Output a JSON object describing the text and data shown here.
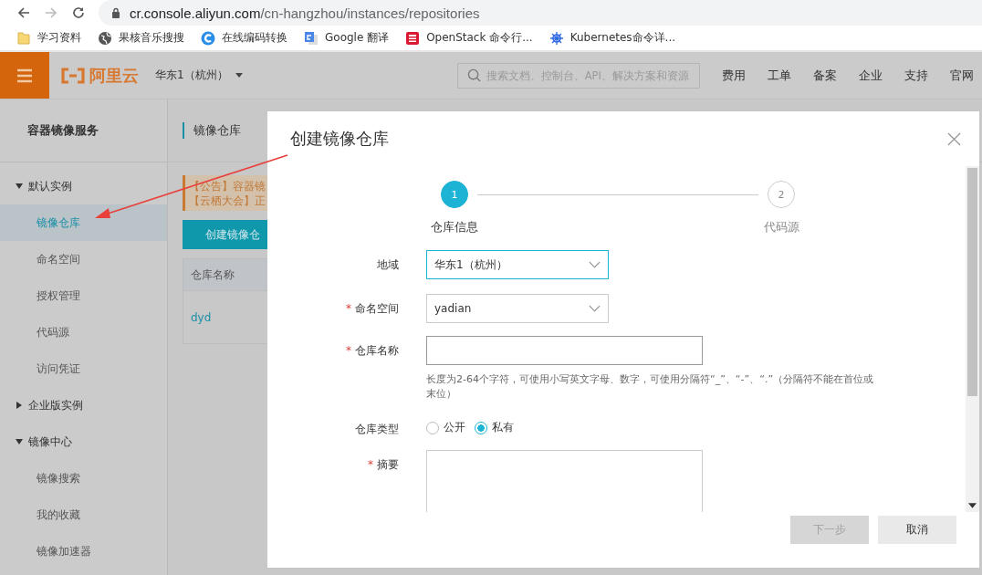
{
  "browser": {
    "url_host": "cr.console.aliyun.com",
    "url_path": "/cn-hangzhou/instances/repositories"
  },
  "bookmarks": [
    {
      "label": "学习资料",
      "kind": "folder"
    },
    {
      "label": "果核音乐搜搜",
      "kind": "globe"
    },
    {
      "label": "在线编码转换",
      "kind": "letter-c"
    },
    {
      "label": "Google 翻译",
      "kind": "translate"
    },
    {
      "label": "OpenStack 命令行...",
      "kind": "openstack"
    },
    {
      "label": "Kubernetes命令详...",
      "kind": "wheel"
    }
  ],
  "header": {
    "logo": "阿里云",
    "region": "华东1（杭州）",
    "search_placeholder": "搜索文档、控制台、API、解决方案和资源",
    "nav": [
      "费用",
      "工单",
      "备案",
      "企业",
      "支持",
      "官网"
    ]
  },
  "sidebar": {
    "title": "容器镜像服务",
    "groups": [
      {
        "label": "默认实例",
        "expanded": true,
        "children": [
          {
            "label": "镜像仓库",
            "selected": true
          },
          {
            "label": "命名空间",
            "selected": false
          },
          {
            "label": "授权管理",
            "selected": false
          },
          {
            "label": "代码源",
            "selected": false
          },
          {
            "label": "访问凭证",
            "selected": false
          }
        ]
      },
      {
        "label": "企业版实例",
        "expanded": false
      },
      {
        "label": "镜像中心",
        "expanded": true,
        "children": [
          {
            "label": "镜像搜索",
            "selected": false
          },
          {
            "label": "我的收藏",
            "selected": false
          },
          {
            "label": "镜像加速器",
            "selected": false
          }
        ]
      }
    ]
  },
  "content": {
    "title": "镜像仓库",
    "notices": [
      "【公告】容器镜",
      "【云栖大会】正"
    ],
    "create_button": "创建镜像仓",
    "table": {
      "columns": [
        "仓库名称"
      ],
      "rows": [
        [
          "dyd"
        ]
      ]
    }
  },
  "dialog": {
    "title": "创建镜像仓库",
    "steps": [
      {
        "number": "1",
        "label": "仓库信息",
        "active": true
      },
      {
        "number": "2",
        "label": "代码源",
        "active": false
      }
    ],
    "fields": [
      {
        "kind": "select",
        "label": "地域",
        "value": "华东1（杭州）",
        "focused": true
      },
      {
        "kind": "select",
        "label": "命名空间",
        "required_mark": "*",
        "value": "yadian",
        "focused": false
      },
      {
        "kind": "input",
        "label": "仓库名称",
        "required_mark": "*",
        "help": "长度为2-64个字符，可使用小写英文字母、数字，可使用分隔符“_”、“-”、“.”（分隔符不能在首位或末位）"
      },
      {
        "kind": "radio",
        "label": "仓库类型",
        "options": [
          {
            "label": "公开",
            "selected": false
          },
          {
            "label": "私有",
            "selected": true
          }
        ]
      },
      {
        "kind": "textarea",
        "label": "摘要",
        "required_mark": "*"
      }
    ],
    "buttons": [
      {
        "label": "下一步",
        "disabled": true
      },
      {
        "label": "取消",
        "disabled": false
      }
    ]
  }
}
